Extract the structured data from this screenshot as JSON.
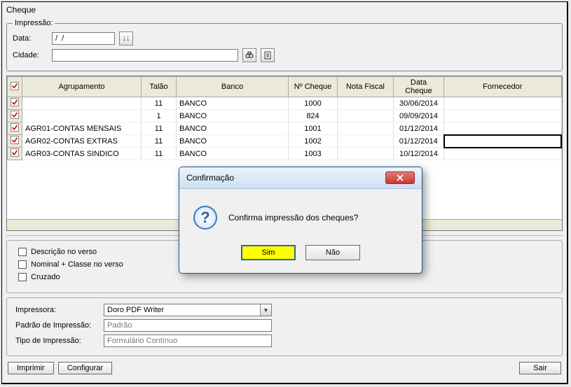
{
  "window_title": "Cheque",
  "impressao_legend": "Impressão:",
  "filters": {
    "data_label": "Data:",
    "data_value": "/  /",
    "cidade_label": "Cidade:",
    "cidade_value": ""
  },
  "grid": {
    "headers": [
      "Agrupamento",
      "Talão",
      "Banco",
      "Nº Cheque",
      "Nota Fiscal",
      "Data Cheque",
      "Fornecedor"
    ],
    "rows": [
      {
        "agr": "",
        "talao": "11",
        "banco": "BANCO",
        "num": "1000",
        "nf": "",
        "data": "30/06/2014",
        "forn": ""
      },
      {
        "agr": "",
        "talao": "1",
        "banco": "BANCO",
        "num": "824",
        "nf": "",
        "data": "09/09/2014",
        "forn": ""
      },
      {
        "agr": "AGR01-CONTAS MENSAIS",
        "talao": "11",
        "banco": "BANCO",
        "num": "1001",
        "nf": "",
        "data": "01/12/2014",
        "forn": ""
      },
      {
        "agr": "AGR02-CONTAS EXTRAS",
        "talao": "11",
        "banco": "BANCO",
        "num": "1002",
        "nf": "",
        "data": "01/12/2014",
        "forn": ""
      },
      {
        "agr": "AGR03-CONTAS SINDICO",
        "talao": "11",
        "banco": "BANCO",
        "num": "1003",
        "nf": "",
        "data": "10/12/2014",
        "forn": ""
      }
    ]
  },
  "options": {
    "descricao": "Descrição no verso",
    "nominal": "Nominal + Classe no verso",
    "cruzado": "Cruzado"
  },
  "print": {
    "impressora_label": "Impressora:",
    "impressora_value": "Doro PDF Writer",
    "padrao_label": "Padrão de Impressão:",
    "padrao_value": "Padrão",
    "tipo_label": "Tipo de Impressão:",
    "tipo_value": "Formulário Contínuo"
  },
  "buttons": {
    "imprimir": "Imprimir",
    "configurar": "Configurar",
    "sair": "Sair"
  },
  "modal": {
    "title": "Confirmação",
    "message": "Confirma impressão dos cheques?",
    "yes": "Sim",
    "no": "Não"
  },
  "icons": {
    "date_picker": "↓↓",
    "binoculars": "🔍",
    "properties": "📄"
  }
}
